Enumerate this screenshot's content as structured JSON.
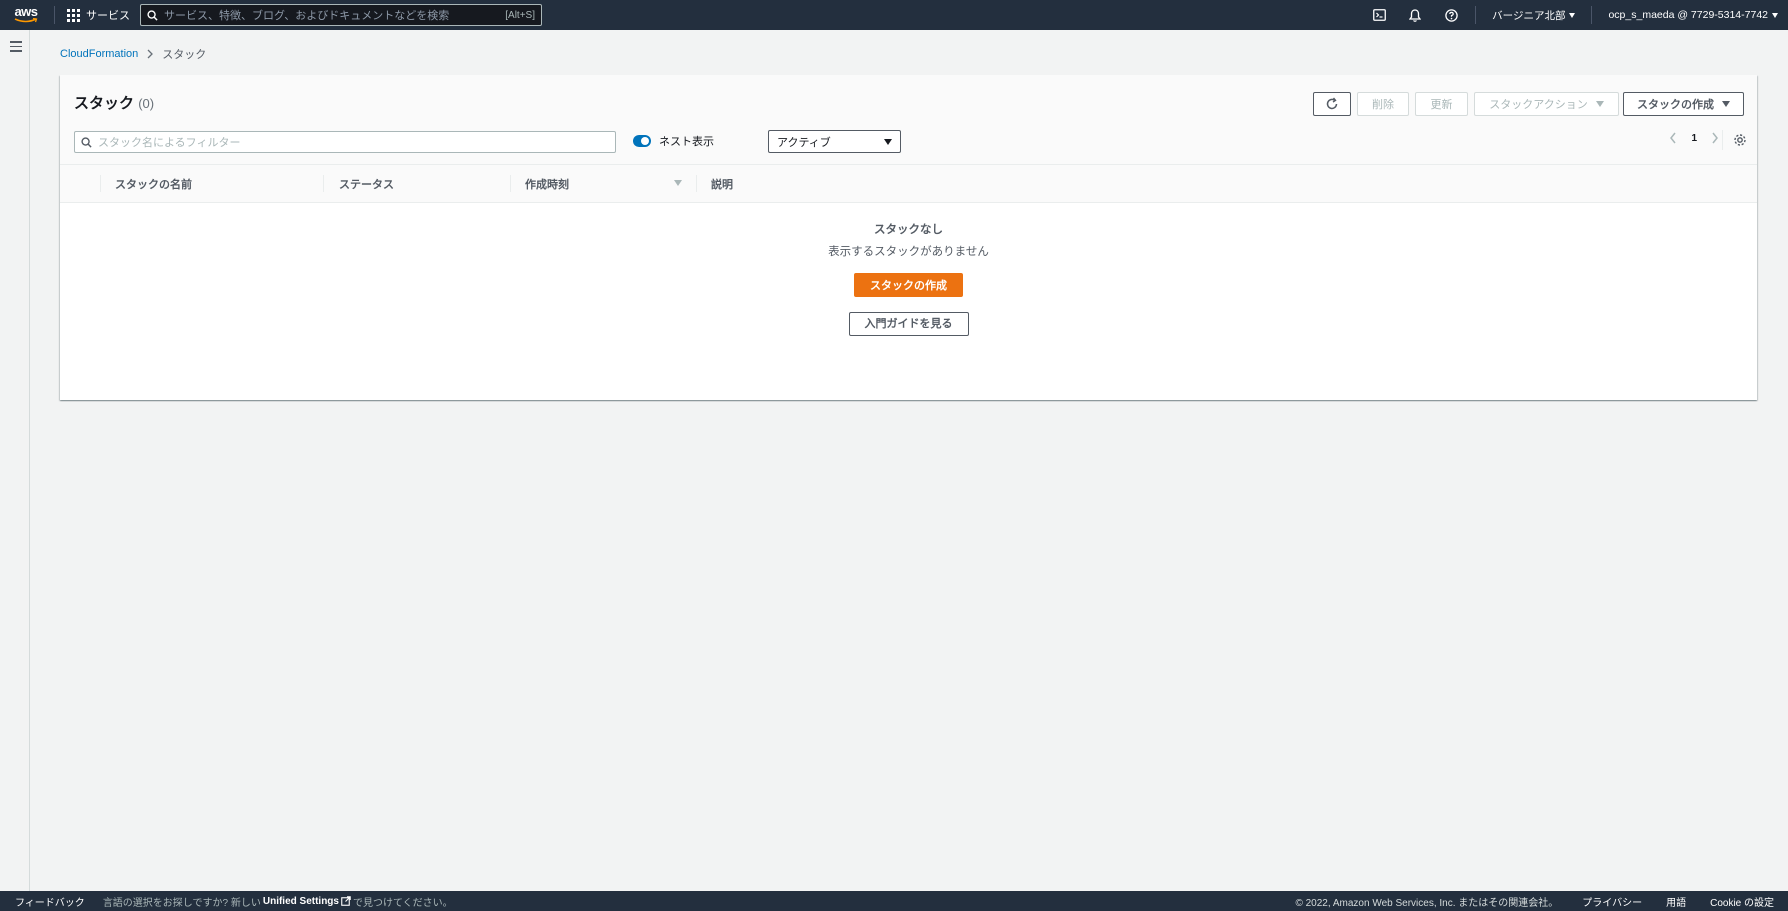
{
  "topnav": {
    "logo_text": "aws",
    "services_label": "サービス",
    "search_placeholder": "サービス、特徴、ブログ、およびドキュメントなどを検索",
    "search_shortcut": "[Alt+S]",
    "region_label": "バージニア北部",
    "account_label": "ocp_s_maeda @ 7729-5314-7742"
  },
  "breadcrumb": {
    "root": "CloudFormation",
    "current": "スタック"
  },
  "stacks_panel": {
    "title": "スタック",
    "count": "(0)",
    "buttons": {
      "delete": "削除",
      "update": "更新",
      "stack_actions": "スタックアクション",
      "create_stack": "スタックの作成"
    },
    "filter_placeholder": "スタック名によるフィルター",
    "nested_toggle_label": "ネスト表示",
    "status_select_value": "アクティブ",
    "page_number": "1",
    "columns": [
      "スタックの名前",
      "ステータス",
      "作成時刻",
      "説明"
    ],
    "empty": {
      "title": "スタックなし",
      "message": "表示するスタックがありません",
      "create_button": "スタックの作成",
      "guide_button": "入門ガイドを見る"
    }
  },
  "footer": {
    "feedback": "フィードバック",
    "lang_prefix": "言語の選択をお探しですか? 新しい",
    "unified_settings": "Unified Settings",
    "lang_suffix": "で見つけてください。",
    "copyright": "© 2022, Amazon Web Services, Inc. またはその関連会社。",
    "privacy": "プライバシー",
    "terms": "用語",
    "cookie": "Cookie の設定"
  },
  "colors": {
    "nav_bg": "#232f3e",
    "primary_orange": "#ec7211",
    "link_blue": "#0073bb",
    "page_bg": "#f2f3f3"
  }
}
